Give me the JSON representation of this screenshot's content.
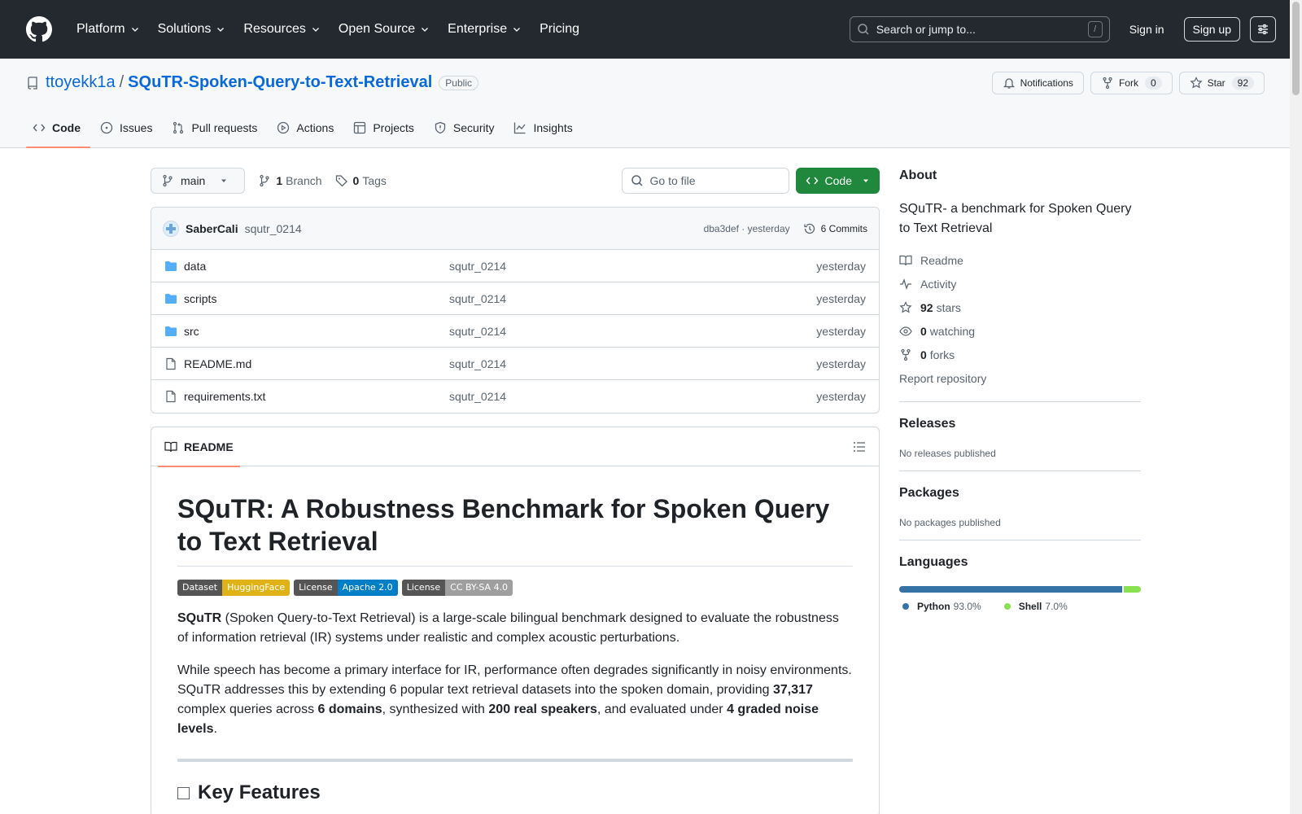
{
  "header": {
    "nav": [
      "Platform",
      "Solutions",
      "Resources",
      "Open Source",
      "Enterprise",
      "Pricing"
    ],
    "search_placeholder": "Search or jump to...",
    "search_key": "/",
    "sign_in": "Sign in",
    "sign_up": "Sign up"
  },
  "repo": {
    "owner": "ttoyekk1a",
    "separator": "/",
    "name": "SQuTR-Spoken-Query-to-Text-Retrieval",
    "visibility": "Public",
    "notifications_label": "Notifications",
    "fork_label": "Fork",
    "fork_count": "0",
    "star_label": "Star",
    "star_count": "92",
    "tabs": [
      "Code",
      "Issues",
      "Pull requests",
      "Actions",
      "Projects",
      "Security",
      "Insights"
    ]
  },
  "toolbar": {
    "branch": "main",
    "branches_count": "1",
    "branches_label": "Branch",
    "tags_count": "0",
    "tags_label": "Tags",
    "goto_placeholder": "Go to file",
    "code_label": "Code"
  },
  "commit": {
    "author": "SaberCali",
    "message": "squtr_0214",
    "sha_time": "dba3def · yesterday",
    "commits_label": "6 Commits"
  },
  "files": [
    {
      "name": "data",
      "type": "folder",
      "message": "squtr_0214",
      "date": "yesterday"
    },
    {
      "name": "scripts",
      "type": "folder",
      "message": "squtr_0214",
      "date": "yesterday"
    },
    {
      "name": "src",
      "type": "folder",
      "message": "squtr_0214",
      "date": "yesterday"
    },
    {
      "name": "README.md",
      "type": "file",
      "message": "squtr_0214",
      "date": "yesterday"
    },
    {
      "name": "requirements.txt",
      "type": "file",
      "message": "squtr_0214",
      "date": "yesterday"
    }
  ],
  "readme": {
    "tab_label": "README",
    "title": "SQuTR: A Robustness Benchmark for Spoken Query to Text Retrieval",
    "badges": [
      {
        "left": "Dataset",
        "right": "HuggingFace",
        "color": "#dfb317"
      },
      {
        "left": "License",
        "right": "Apache 2.0",
        "color": "#007ec6"
      },
      {
        "left": "License",
        "right": "CC BY-SA 4.0",
        "color": "#9f9f9f"
      }
    ],
    "p1_bold": "SQuTR",
    "p1_rest": " (Spoken Query-to-Text Retrieval) is a large-scale bilingual benchmark designed to evaluate the robustness of information retrieval (IR) systems under realistic and complex acoustic perturbations.",
    "p2_a": "While speech has become a primary interface for IR, performance often degrades significantly in noisy environments. SQuTR addresses this by extending 6 popular text retrieval datasets into the spoken domain, providing ",
    "p2_b1": "37,317",
    "p2_c": " complex queries across ",
    "p2_b2": "6 domains",
    "p2_d": ", synthesized with ",
    "p2_b3": "200 real speakers",
    "p2_e": ", and evaluated under ",
    "p2_b4": "4 graded noise levels",
    "p2_f": ".",
    "h2": "Key Features"
  },
  "sidebar": {
    "about_title": "About",
    "description": "SQuTR- a benchmark for Spoken Query to Text Retrieval",
    "readme": "Readme",
    "activity": "Activity",
    "stars_count": "92",
    "stars_label": "stars",
    "watching_count": "0",
    "watching_label": "watching",
    "forks_count": "0",
    "forks_label": "forks",
    "report": "Report repository",
    "releases_title": "Releases",
    "releases_empty": "No releases published",
    "packages_title": "Packages",
    "packages_empty": "No packages published",
    "languages_title": "Languages",
    "languages": [
      {
        "name": "Python",
        "percent": "93.0%",
        "value": 93.0,
        "color": "#3572A5"
      },
      {
        "name": "Shell",
        "percent": "7.0%",
        "value": 7.0,
        "color": "#89e051"
      }
    ]
  },
  "colors": {
    "header_bg": "#24292f",
    "link": "#0969da",
    "primary_button": "#1f883d",
    "tab_underline": "#fd8c73"
  }
}
